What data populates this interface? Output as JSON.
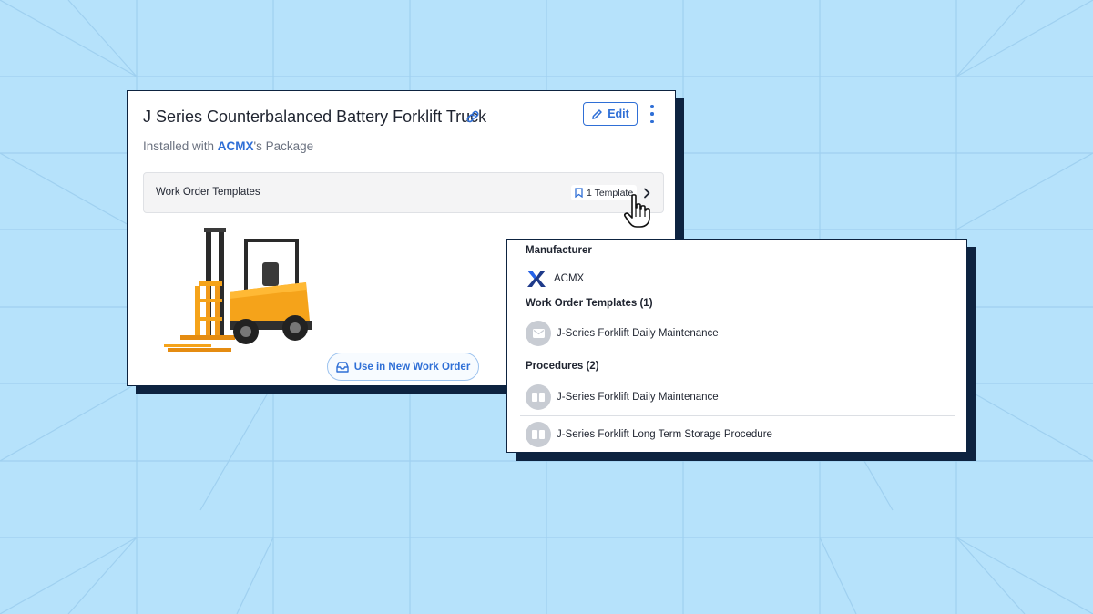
{
  "asset": {
    "title": "J Series Counterbalanced Battery Forklift Truck",
    "edit_label": "Edit",
    "installed_prefix": "Installed with ",
    "installed_brand": "ACMX",
    "installed_suffix": "'s Package",
    "work_order_templates_label": "Work Order Templates",
    "template_count_label": "1 Template",
    "use_button_label": "Use in New Work Order"
  },
  "panel": {
    "manufacturer_heading": "Manufacturer",
    "manufacturer_name": "ACMX",
    "templates_heading": "Work Order Templates (1)",
    "templates": [
      {
        "name": "J-Series Forklift Daily Maintenance"
      }
    ],
    "procedures_heading": "Procedures (2)",
    "procedures": [
      {
        "name": "J-Series Forklift Daily Maintenance"
      },
      {
        "name": "J-Series Forklift Long Term Storage Procedure"
      }
    ]
  },
  "icons": {
    "link": "link-icon",
    "edit": "pencil-icon",
    "more": "kebab-menu-icon",
    "template": "bookmark-icon",
    "chevron": "chevron-right-icon",
    "use": "inbox-tray-icon",
    "cursor": "hand-pointer-icon",
    "brand_logo": "acmx-x-logo",
    "template_item": "envelope-icon",
    "procedure_item": "procedure-icon"
  },
  "colors": {
    "background": "#b6e2fb",
    "accent": "#2f6fd6",
    "card_shadow": "#0d2340",
    "forklift_body": "#f5a31a"
  }
}
